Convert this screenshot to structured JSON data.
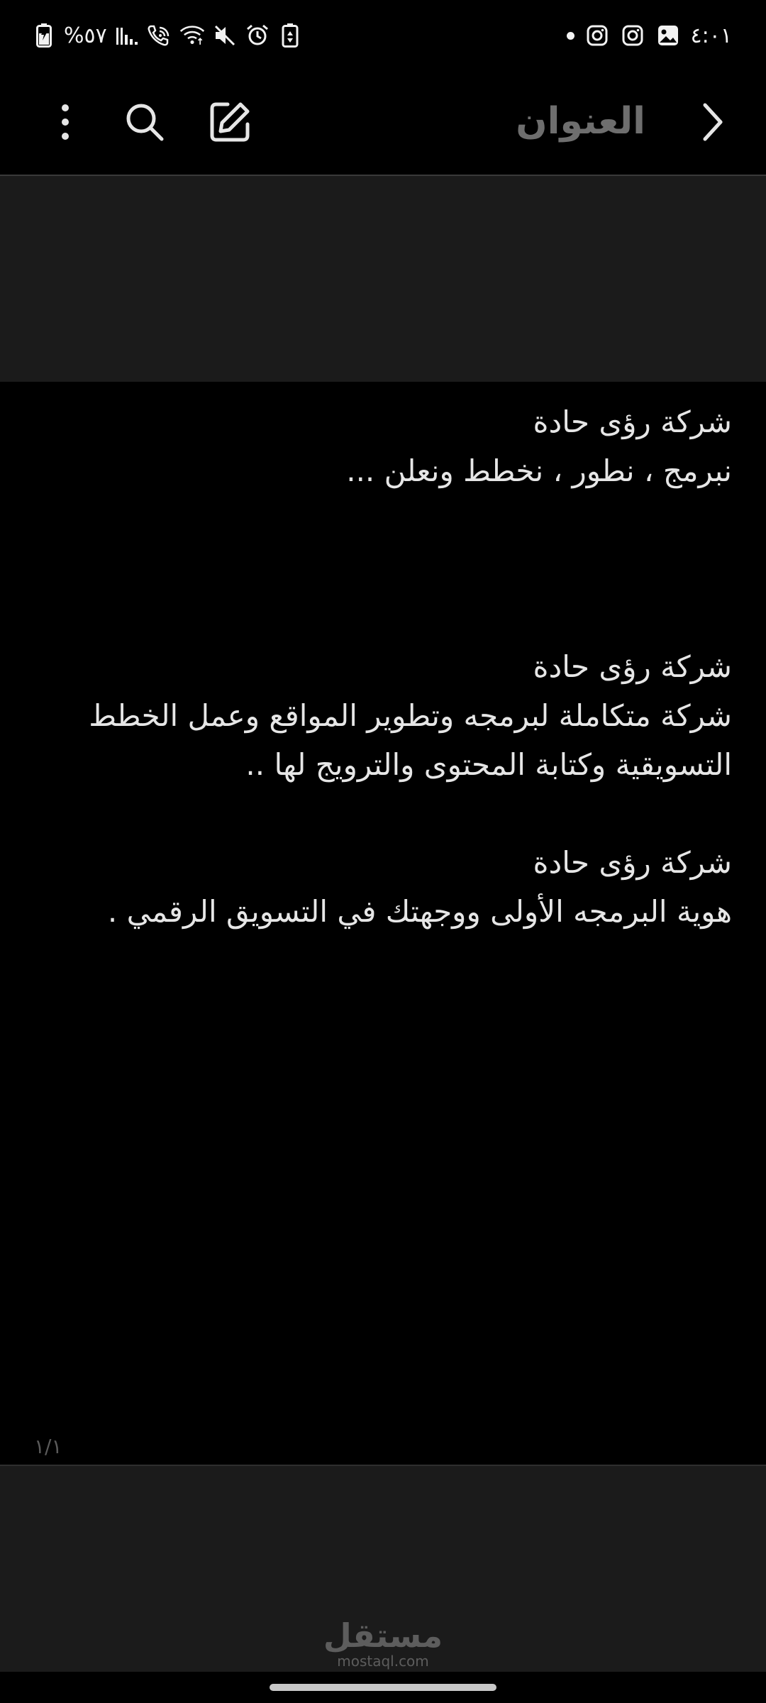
{
  "status_bar": {
    "time": "٤:٠١",
    "battery_percent": "%٥٧",
    "icons_right": [
      "notification-dot",
      "instagram-icon",
      "instagram-icon",
      "gallery-icon"
    ],
    "icons_left": [
      "battery-saver-icon",
      "alarm-icon",
      "mute-icon",
      "wifi-icon",
      "wifi-calling-icon",
      "signal-icon"
    ]
  },
  "toolbar": {
    "title_placeholder": "العنوان",
    "icons": [
      "chevron-right-icon",
      "edit-icon",
      "search-icon",
      "more-vertical-icon"
    ]
  },
  "note": {
    "lines": [
      "شركة رؤى حادة",
      "نبرمج ، نطور ، نخطط ونعلن ...",
      "",
      "",
      "",
      "شركة رؤى حادة",
      "شركة متكاملة لبرمجه وتطوير المواقع وعمل الخطط",
      "التسويقية وكتابة المحتوى والترويج لها ..",
      "",
      "شركة رؤى حادة",
      "هوية البرمجه الأولى ووجهتك في التسويق الرقمي ."
    ]
  },
  "page_indicator": "١/١",
  "watermark": {
    "arabic": "مستقل",
    "latin": "mostaql.com"
  },
  "colors": {
    "background": "#000000",
    "band": "#1b1b1b",
    "text": "#e6e6e6",
    "muted": "#6e6e6e"
  }
}
